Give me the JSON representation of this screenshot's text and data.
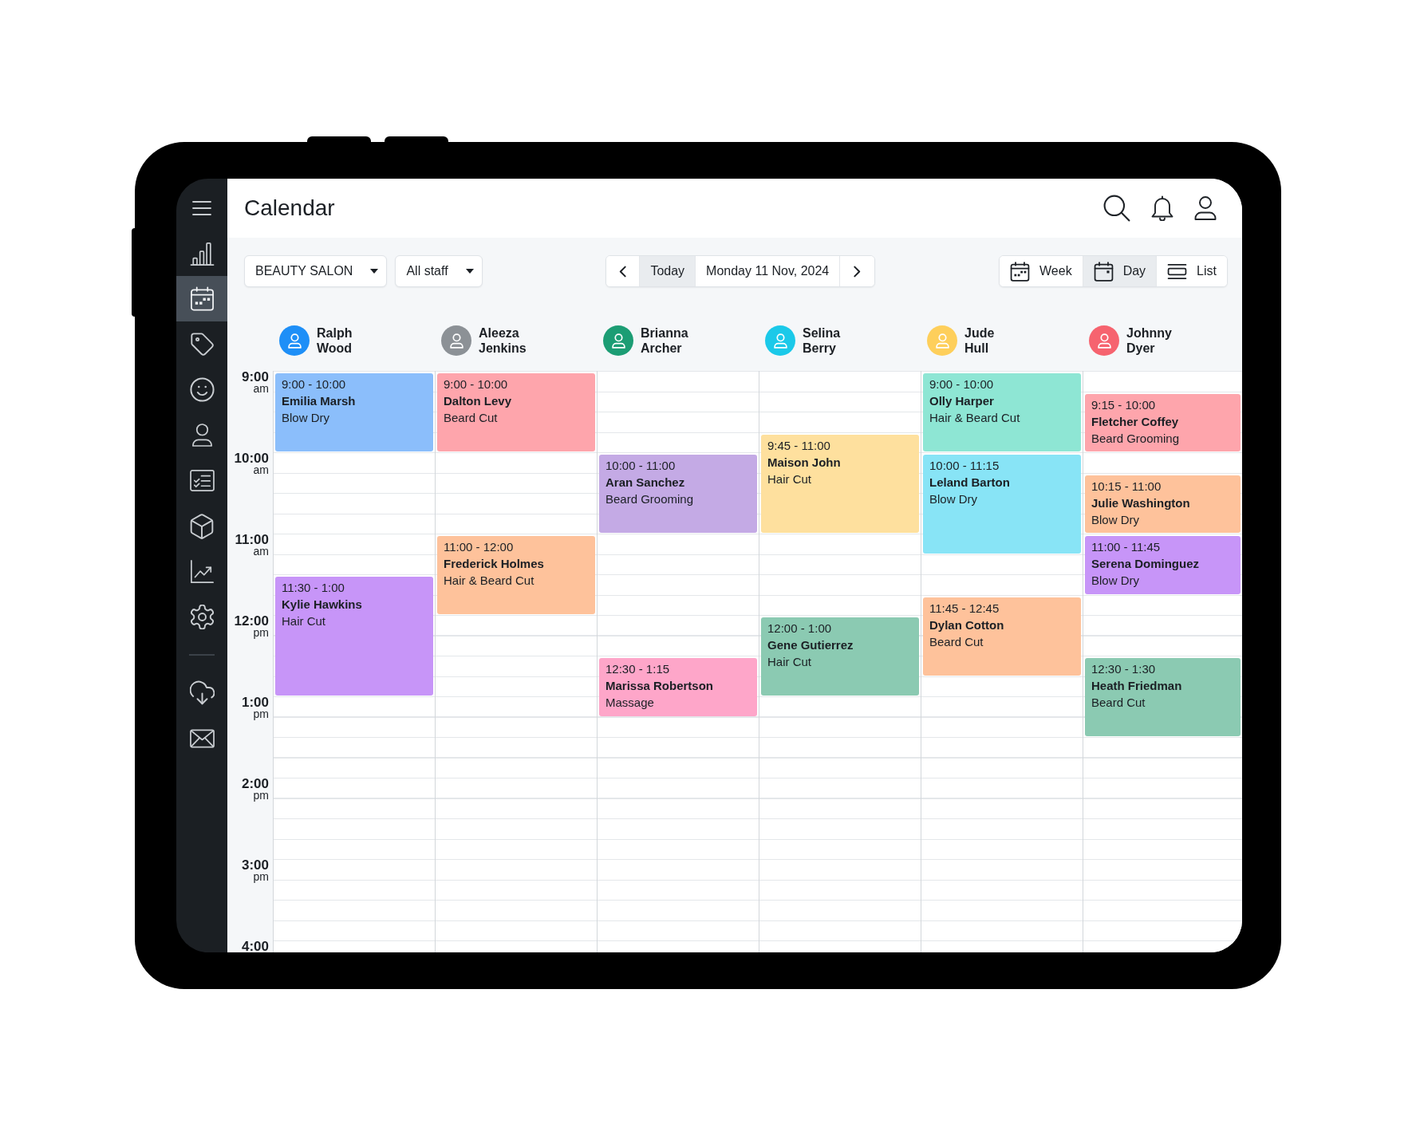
{
  "page_title": "Calendar",
  "sidebar": {
    "items": [
      {
        "selected": false
      },
      {
        "selected": true
      },
      {
        "selected": false
      },
      {
        "selected": false
      },
      {
        "selected": false
      },
      {
        "selected": false
      },
      {
        "selected": false
      },
      {
        "selected": false
      },
      {
        "selected": false
      }
    ],
    "bottom_items": [
      {
        "selected": false
      },
      {
        "selected": false
      }
    ]
  },
  "toolbar": {
    "location_select": {
      "value": "BEAUTY SALON"
    },
    "staff_select": {
      "value": "All staff"
    },
    "date_nav": {
      "today": "Today",
      "date": "Monday 11 Nov, 2024"
    },
    "views": [
      {
        "label": "Week",
        "selected": false
      },
      {
        "label": "Day",
        "selected": true
      },
      {
        "label": "List",
        "selected": false
      }
    ]
  },
  "time_labels": [
    {
      "hour": "9:00",
      "period": "am"
    },
    {
      "hour": "10:00",
      "period": "am"
    },
    {
      "hour": "11:00",
      "period": "am"
    },
    {
      "hour": "12:00",
      "period": "pm"
    },
    {
      "hour": "1:00",
      "period": "pm"
    },
    {
      "hour": "2:00",
      "period": "pm"
    },
    {
      "hour": "3:00",
      "period": "pm"
    },
    {
      "hour": "4:00"
    }
  ],
  "columns": [
    {
      "staff": {
        "name": "Ralph Wood",
        "color": "#1e8ff7"
      },
      "appointments": [
        {
          "time": "9:00 - 10:00",
          "client": "Emilia Marsh",
          "service": "Blow Dry",
          "color": "#8bbefb"
        },
        {
          "time": "11:30 - 1:00",
          "client": "Kylie Hawkins",
          "service": "Hair Cut",
          "color": "#c795f8"
        }
      ]
    },
    {
      "staff": {
        "name": "Aleeza Jenkins",
        "color": "#8c9196"
      },
      "appointments": [
        {
          "time": "9:00 - 10:00",
          "client": "Dalton Levy",
          "service": "Beard Cut",
          "color": "#fea5ac"
        },
        {
          "time": "11:00 - 12:00",
          "client": "Frederick Holmes",
          "service": "Hair & Beard Cut",
          "color": "#fec29b"
        }
      ]
    },
    {
      "staff": {
        "name": "Brianna Archer",
        "color": "#1c9d74"
      },
      "appointments": [
        {
          "time": "10:00 - 11:00",
          "client": "Aran Sanchez",
          "service": "Beard Grooming",
          "color": "#c4aae5"
        },
        {
          "time": "12:30 - 1:15",
          "client": "Marissa Robertson",
          "service": "Massage",
          "color": "#fea6c9"
        }
      ]
    },
    {
      "staff": {
        "name": "Selina Berry",
        "color": "#1bc9e9"
      },
      "appointments": [
        {
          "time": "9:45 - 11:00",
          "client": "Maison John",
          "service": "Hair Cut",
          "color": "#fee09e"
        },
        {
          "time": "12:00 - 1:00",
          "client": "Gene Gutierrez",
          "service": "Hair Cut",
          "color": "#8bcab2"
        }
      ]
    },
    {
      "staff": {
        "name": "Jude Hull",
        "color": "#fecf5b"
      },
      "appointments": [
        {
          "time": "9:00 - 10:00",
          "client": "Olly Harper",
          "service": "Hair & Beard Cut",
          "color": "#8ee6d4"
        },
        {
          "time": "10:00 - 11:15",
          "client": "Leland Barton",
          "service": "Blow Dry",
          "color": "#88e4f6"
        },
        {
          "time": "11:45 - 12:45",
          "client": "Dylan Cotton",
          "service": "Beard Cut",
          "color": "#fec29b"
        }
      ]
    },
    {
      "staff": {
        "name": "Johnny Dyer",
        "color": "#f6636f"
      },
      "appointments": [
        {
          "time": "9:15 - 10:00",
          "client": "Fletcher Coffey",
          "service": "Beard Grooming",
          "color": "#fea5ac"
        },
        {
          "time": "10:15 - 11:00",
          "client": "Julie Washington",
          "service": "Blow Dry",
          "color": "#fec29b"
        },
        {
          "time": "11:00 - 11:45",
          "client": "Serena Dominguez",
          "service": "Blow Dry",
          "color": "#c795f8"
        },
        {
          "time": "12:30 - 1:30",
          "client": "Heath Friedman",
          "service": "Beard Cut",
          "color": "#8bcab2"
        }
      ]
    }
  ]
}
